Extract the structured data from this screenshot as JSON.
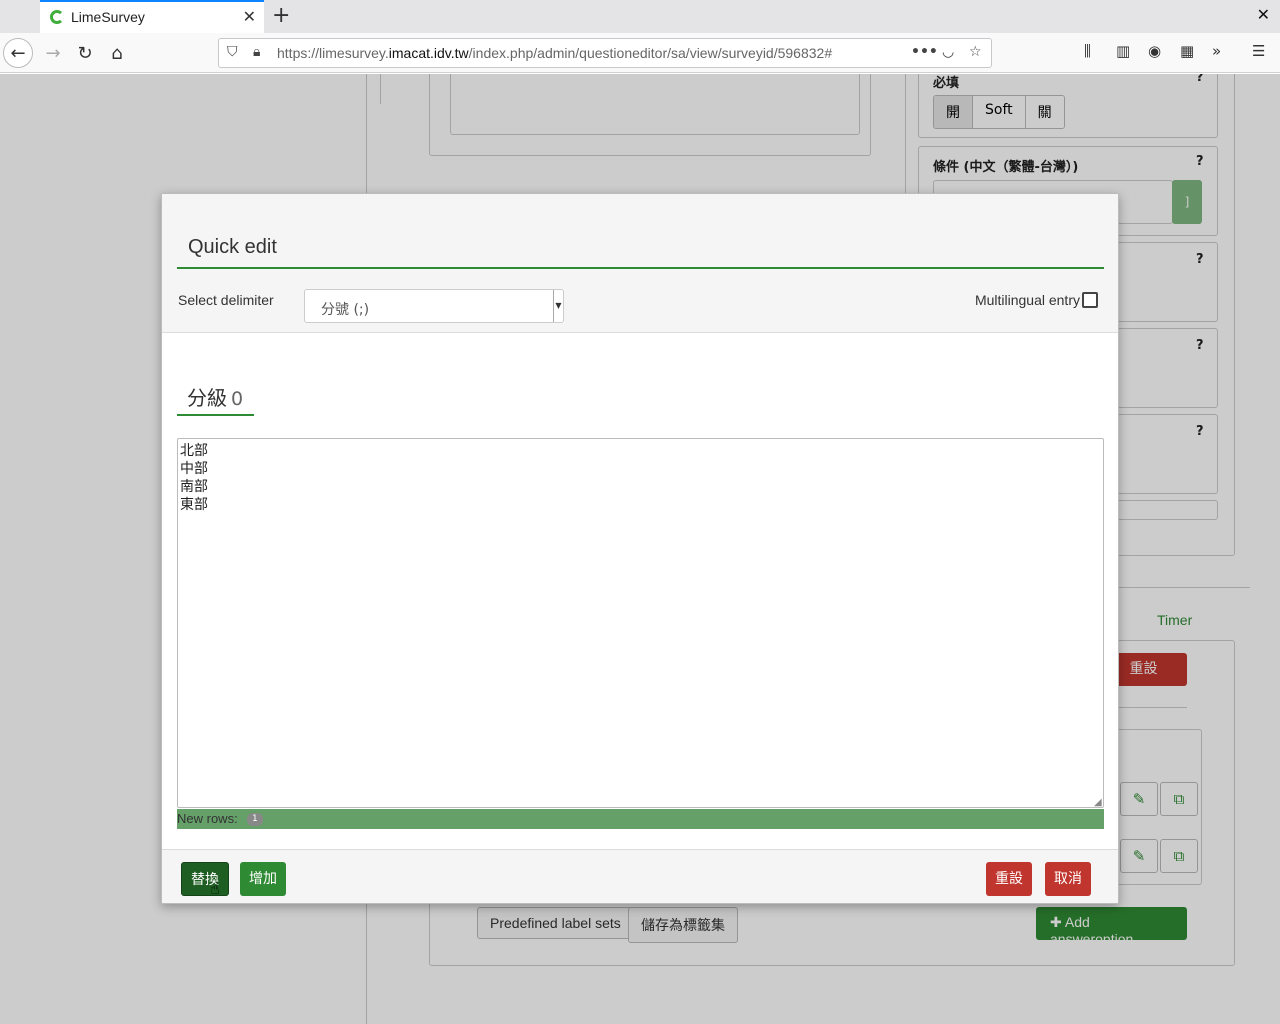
{
  "browser": {
    "tab_title": "LimeSurvey",
    "url_prefix": "https://limesurvey.",
    "url_domain": "imacat.idv.tw",
    "url_path": "/index.php/admin/questioneditor/sa/view/surveyid/596832#"
  },
  "background": {
    "mandatory_label": "必填",
    "mandatory_options": [
      "開",
      "Soft",
      "關"
    ],
    "condition_label": "條件 (中文（繁體-台灣）)",
    "help_mark": "?",
    "timer_tab": "Timer",
    "reset_label": "重設",
    "predefined_label_sets": "Predefined label sets",
    "save_as_label_set": "儲存為標籤集",
    "add_answer_option": "Add answeroption",
    "bracket": "]"
  },
  "modal": {
    "title": "Quick edit",
    "delimiter_label": "Select delimiter",
    "delimiter_value": "分號 (;)",
    "multilingual_label": "Multilingual entry",
    "section_name": "分級",
    "section_count": "0",
    "textarea_content": "北部\n中部\n南部\n東部",
    "new_rows_label": "New rows:",
    "new_rows_count": "1",
    "buttons": {
      "replace": "替換",
      "add": "增加",
      "reset": "重設",
      "cancel": "取消"
    }
  }
}
